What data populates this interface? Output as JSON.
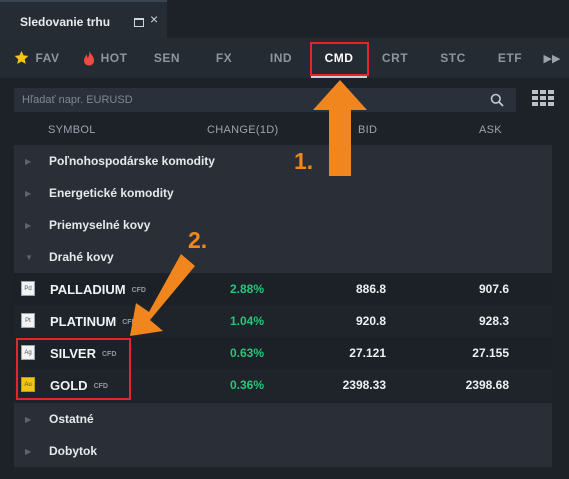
{
  "panel": {
    "title": "Sledovanie trhu"
  },
  "tabs": [
    {
      "label": "FAV",
      "icon": "star-icon"
    },
    {
      "label": "HOT",
      "icon": "flame-icon"
    },
    {
      "label": "SEN"
    },
    {
      "label": "FX"
    },
    {
      "label": "IND"
    },
    {
      "label": "CMD",
      "active": true
    },
    {
      "label": "CRT"
    },
    {
      "label": "STC"
    },
    {
      "label": "ETF"
    }
  ],
  "search": {
    "placeholder": "Hľadať napr. EURUSD"
  },
  "columns": {
    "symbol": "SYMBOL",
    "change": "CHANGE(1D)",
    "bid": "BID",
    "ask": "ASK"
  },
  "groups": {
    "agri": "Poľnohospodárske komodity",
    "energy": "Energetické komodity",
    "industrial": "Priemyselné kovy",
    "precious": "Drahé kovy",
    "other": "Ostatné",
    "livestock": "Dobytok"
  },
  "instruments": [
    {
      "icon_text": "Pd",
      "name": "PALLADIUM",
      "tag": "CFD",
      "change": "2.88%",
      "bid": "886.8",
      "ask": "907.6"
    },
    {
      "icon_text": "Pt",
      "name": "PLATINUM",
      "tag": "CFD",
      "change": "1.04%",
      "bid": "920.8",
      "ask": "928.3"
    },
    {
      "icon_text": "Ag",
      "name": "SILVER",
      "tag": "CFD",
      "change": "0.63%",
      "bid": "27.121",
      "ask": "27.155"
    },
    {
      "icon_text": "Au",
      "name": "GOLD",
      "tag": "CFD",
      "change": "0.36%",
      "bid": "2398.33",
      "ask": "2398.68"
    }
  ],
  "annotations": {
    "step1": "1.",
    "step2": "2."
  },
  "colors": {
    "positive": "#2fc17a",
    "highlight": "#e3262b",
    "annotation": "#f2861e",
    "gold_icon": "#f0c419"
  }
}
